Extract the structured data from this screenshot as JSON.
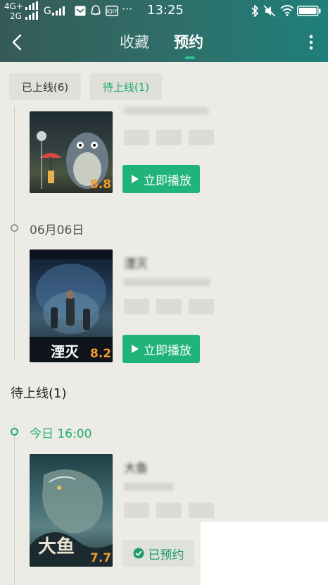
{
  "status_bar": {
    "network_top": "4G+",
    "network_bottom": "2G",
    "carrier": "G",
    "time": "13:25",
    "more": "···"
  },
  "header": {
    "tabs": [
      {
        "label": "收藏",
        "active": false
      },
      {
        "label": "预约",
        "active": true
      }
    ]
  },
  "filters": [
    {
      "label": "已上线(6)",
      "active": false
    },
    {
      "label": "待上线(1)",
      "active": true
    }
  ],
  "released": {
    "items": [
      {
        "date": "",
        "title": "",
        "rating": "8.8",
        "button": "立即播放"
      },
      {
        "date": "06月06日",
        "title": "湮灭",
        "rating": "8.2",
        "button": "立即播放"
      }
    ]
  },
  "upcoming": {
    "section_title": "待上线(1)",
    "items": [
      {
        "date": "今日 16:00",
        "title": "大鱼",
        "rating": "7.7",
        "button": "已预约"
      }
    ]
  },
  "colors": {
    "accent": "#20b37a",
    "rating": "#f39a2f",
    "header_start": "#355a57",
    "header_end": "#1f7f7a"
  }
}
